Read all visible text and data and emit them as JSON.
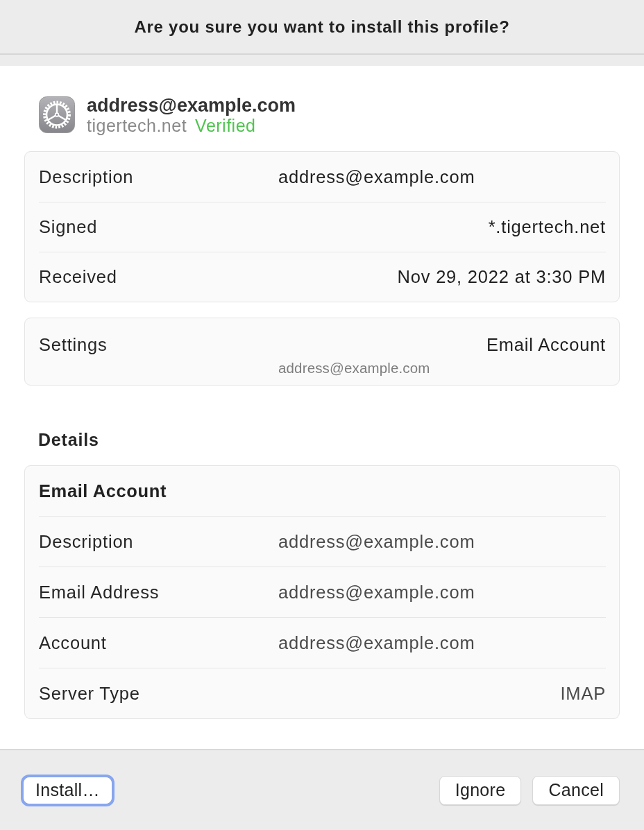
{
  "title": "Are you sure you want to install this profile?",
  "profile": {
    "name": "address@example.com",
    "organization": "tigertech.net",
    "status": "Verified"
  },
  "summary": [
    {
      "label": "Description",
      "value": "address@example.com",
      "kind": "column"
    },
    {
      "label": "Signed",
      "value": "*.tigertech.net",
      "kind": "trailing"
    },
    {
      "label": "Received",
      "value": "Nov 29, 2022 at 3:30 PM",
      "kind": "trailing"
    }
  ],
  "settings": {
    "label": "Settings",
    "value": "Email Account",
    "sub_value": "address@example.com"
  },
  "details": {
    "heading": "Details",
    "section_title": "Email Account",
    "rows": [
      {
        "label": "Description",
        "value": "address@example.com",
        "kind": "column"
      },
      {
        "label": "Email Address",
        "value": "address@example.com",
        "kind": "column"
      },
      {
        "label": "Account",
        "value": "address@example.com",
        "kind": "column"
      },
      {
        "label": "Server Type",
        "value": "IMAP",
        "kind": "trailing"
      }
    ]
  },
  "buttons": [
    {
      "label": "Install…",
      "focused": true
    },
    {
      "label": "Ignore",
      "focused": false
    },
    {
      "label": "Cancel",
      "focused": false
    }
  ]
}
